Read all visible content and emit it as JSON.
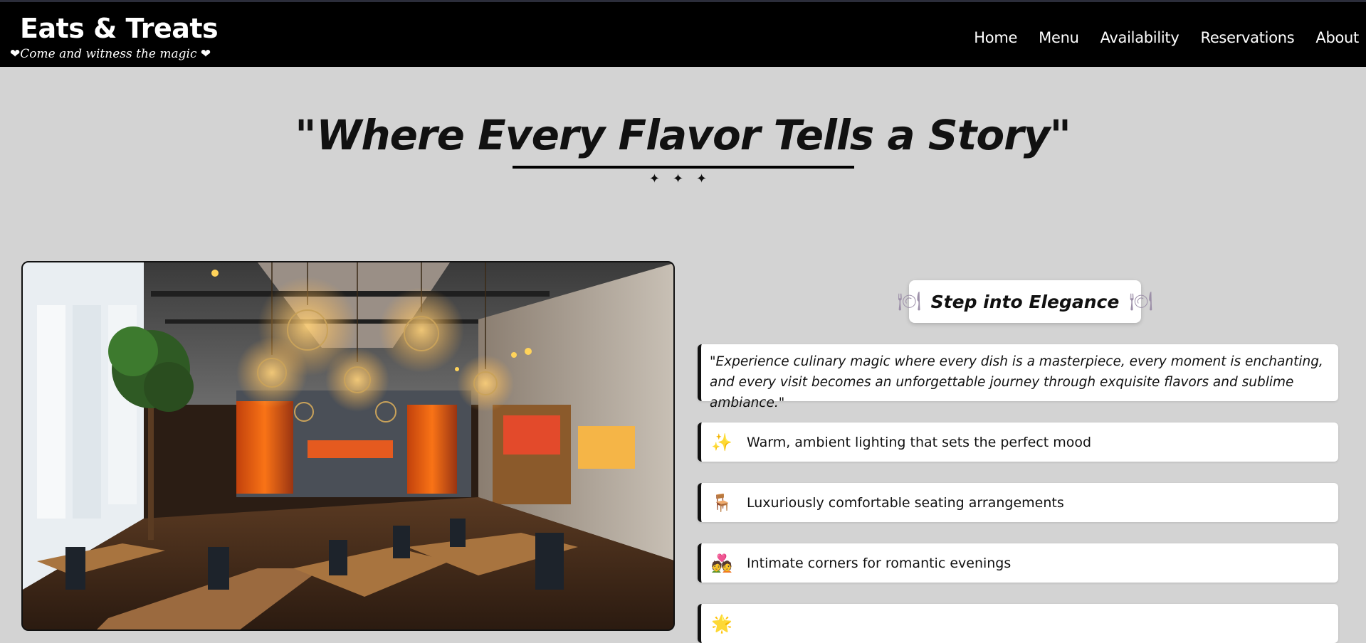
{
  "header": {
    "brand": "Eats & Treats",
    "tagline": "Come and witness the magic",
    "tagline_heart": "❤",
    "nav": [
      "Home",
      "Menu",
      "Availability",
      "Reservations",
      "About"
    ]
  },
  "hero": {
    "open_quote": "\"",
    "title": "Where Every Flavor Tells a Story",
    "close_quote": "\"",
    "ornament": "✦✦✦"
  },
  "photo": {
    "alt": "Restaurant interior with pendant lights, wooden tables and black chairs"
  },
  "elegance": {
    "icon_left": "plate-icon",
    "label": "Step into Elegance",
    "icon_right": "plate-icon"
  },
  "quote": "\"Experience culinary magic where every dish is a masterpiece, every moment is enchanting, and every visit becomes an unforgettable journey through exquisite flavors and sublime ambiance.\"",
  "features": [
    {
      "icon": "sparkles-icon",
      "glyph": "✨",
      "text": "Warm, ambient lighting that sets the perfect mood"
    },
    {
      "icon": "chair-icon",
      "glyph": "🪑",
      "text": "Luxuriously comfortable seating arrangements"
    },
    {
      "icon": "couple-heart-icon",
      "glyph": "💑",
      "text": "Intimate corners for romantic evenings"
    },
    {
      "icon": "star-icon",
      "glyph": "🌟",
      "text": ""
    }
  ],
  "colors": {
    "background": "#d3d3d3",
    "header": "#000000",
    "card": "#ffffff",
    "accent": "#111111"
  }
}
